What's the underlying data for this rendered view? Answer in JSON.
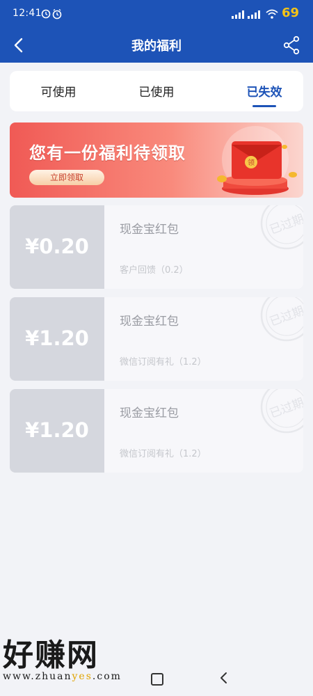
{
  "status_bar": {
    "time": "12:41",
    "battery": "69",
    "icons": [
      "alarm-icon",
      "clock-icon",
      "signal-icon",
      "signal-icon",
      "wifi-icon"
    ]
  },
  "header": {
    "title": "我的福利",
    "back_icon": "chevron-left-icon",
    "share_icon": "share-icon"
  },
  "tabs": [
    {
      "label": "可使用",
      "active": false
    },
    {
      "label": "已使用",
      "active": false
    },
    {
      "label": "已失效",
      "active": true
    }
  ],
  "banner": {
    "title": "您有一份福利待领取",
    "button": "立即领取",
    "envelope_char": "领"
  },
  "coupons": [
    {
      "amount": "¥0.20",
      "name": "现金宝红包",
      "desc": "客户回馈（0.2）",
      "stamp": "已过期"
    },
    {
      "amount": "¥1.20",
      "name": "现金宝红包",
      "desc": "微信订阅有礼（1.2）",
      "stamp": "已过期"
    },
    {
      "amount": "¥1.20",
      "name": "现金宝红包",
      "desc": "微信订阅有礼（1.2）",
      "stamp": "已过期"
    }
  ],
  "watermark": {
    "big": "好赚网",
    "site_prefix": "www.zhuan",
    "site_highlight": "yes",
    "site_suffix": ".com"
  },
  "colors": {
    "brand": "#1d53b7",
    "banner_red": "#f05a55",
    "coupon_grey": "#d5d7de",
    "battery_yellow": "#f3c316"
  }
}
